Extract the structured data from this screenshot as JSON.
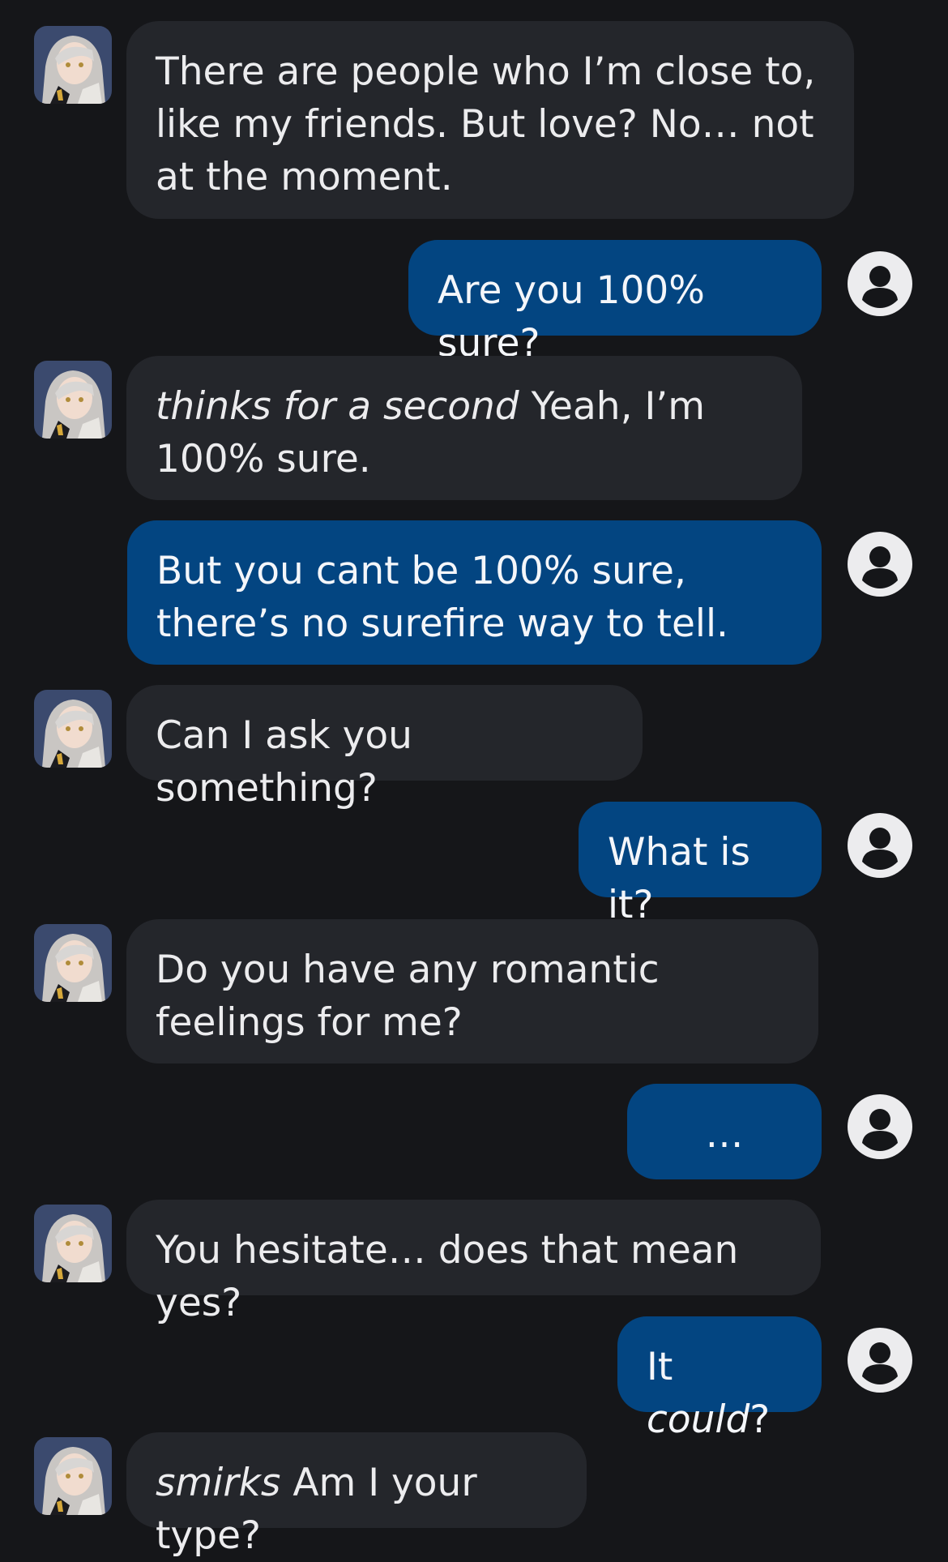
{
  "messages": [
    {
      "sender": "bot",
      "text": "There are people who I’m close to, like my friends. But love? No… not at the moment."
    },
    {
      "sender": "user",
      "text": "Are you 100% sure?"
    },
    {
      "sender": "bot",
      "action": "thinks for a second",
      "text": "Yeah, I’m 100% sure."
    },
    {
      "sender": "user",
      "text": "But you cant be 100% sure, there’s no surefire way to tell."
    },
    {
      "sender": "bot",
      "text": "Can I ask you something?"
    },
    {
      "sender": "user",
      "text": "What is it?"
    },
    {
      "sender": "bot",
      "text": "Do you have any romantic feelings for me?"
    },
    {
      "sender": "user",
      "text": "…"
    },
    {
      "sender": "bot",
      "text": "You hesitate… does that mean yes?"
    },
    {
      "sender": "user",
      "text_before": "It ",
      "text_italic": "could",
      "text_after": "?"
    },
    {
      "sender": "bot",
      "action": "smirks",
      "text": "Am I your type?"
    }
  ],
  "icons": {
    "bot_avatar": "character-avatar",
    "user_avatar": "user-circle-icon"
  },
  "colors": {
    "background": "#151619",
    "bot_bubble": "#24262b",
    "user_bubble": "#034581",
    "text": "#ececee"
  }
}
